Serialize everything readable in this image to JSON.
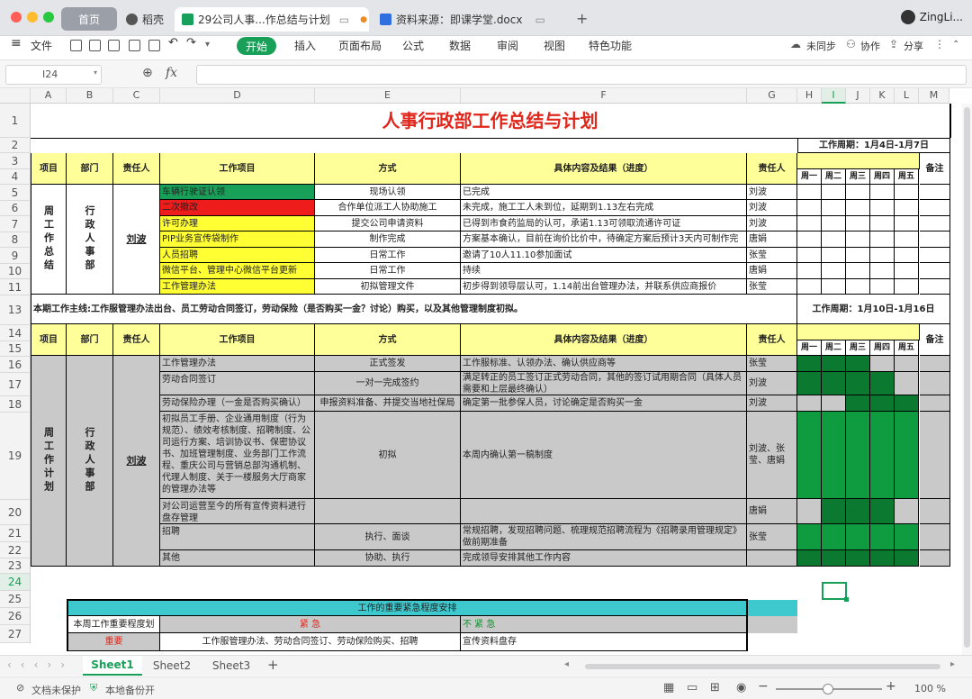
{
  "window": {
    "home_tab": "首页",
    "tab2": "稻壳",
    "tab3": "29公司人事...作总结与计划",
    "tab4": "资料来源：即课学堂.docx",
    "user": "ZingLi..."
  },
  "menu": {
    "file": "文件",
    "start": "开始",
    "insert": "插入",
    "layout": "页面布局",
    "formula": "公式",
    "data": "数据",
    "review": "审阅",
    "view": "视图",
    "special": "特色功能",
    "sync": "未同步",
    "collab": "协作",
    "share": "分享"
  },
  "formula_bar": {
    "cell_ref": "I24",
    "fx": "fx"
  },
  "columns": [
    "A",
    "B",
    "C",
    "D",
    "E",
    "F",
    "G",
    "H",
    "I",
    "J",
    "K",
    "L",
    "M"
  ],
  "rows": [
    "1",
    "2",
    "3",
    "4",
    "5",
    "6",
    "7",
    "8",
    "9",
    "10",
    "11",
    "13",
    "14",
    "15",
    "16",
    "17",
    "18",
    "19",
    "20",
    "21",
    "22",
    "23",
    "24",
    "25",
    "26",
    "27"
  ],
  "sheet": {
    "title": "人事行政部工作总结与计划",
    "period1": "工作周期：1月4日-1月7日",
    "period2": "工作周期：1月10日-1月16日",
    "headers": {
      "item": "项目",
      "dept": "部门",
      "owner": "责任人",
      "work": "工作项目",
      "method": "方式",
      "detail": "具体内容及结果（进度）",
      "resp": "责任人",
      "remark": "备注",
      "days": [
        "周一",
        "周二",
        "周三",
        "周四",
        "周五"
      ]
    },
    "s1": {
      "item": "周工作总结",
      "dept": "行政人事部",
      "owner": "刘波",
      "rows": [
        {
          "work": "车辆行驶证认领",
          "method": "现场认领",
          "detail": "已完成",
          "resp": "刘波"
        },
        {
          "work": "二次撤改",
          "method": "合作单位派工人协助施工",
          "detail": "未完成，施工工人未到位，延期到1.13左右完成",
          "resp": "刘波"
        },
        {
          "work": "许可办理",
          "method": "提交公司申请资料",
          "detail": "已得到市食药监局的认可，承诺1.13可领取流通许可证",
          "resp": "刘波"
        },
        {
          "work": "PIP业务宣传袋制作",
          "method": "制作完成",
          "detail": "方案基本确认，目前在询价比价中，待确定方案后预计3天内可制作完",
          "resp": "唐娟"
        },
        {
          "work": "人员招聘",
          "method": "日常工作",
          "detail": "邀请了10人11.10参加面试",
          "resp": "张莹"
        },
        {
          "work": "微信平台、管理中心微信平台更新",
          "method": "日常工作",
          "detail": "持续",
          "resp": "唐娟"
        },
        {
          "work": "工作管理办法",
          "method": "初拟管理文件",
          "detail": "初步得到领导层认可，1.14前出台管理办法，并联系供应商报价",
          "resp": "张莹"
        }
      ]
    },
    "mainline": "本期工作主线:工作服管理办法出台、员工劳动合同签订，劳动保险（是否购买一金？讨论）购买，以及其他管理制度初拟。",
    "s2": {
      "item": "周工作计划",
      "dept": "行政人事部",
      "owner": "刘波",
      "rows": [
        {
          "work": "工作管理办法",
          "method": "正式签发",
          "detail": "工作服标准、认领办法、确认供应商等",
          "resp": "张莹"
        },
        {
          "work": "劳动合同签订",
          "method": "一对一完成签约",
          "detail": "满足转正的员工签订正式劳动合同，其他的签订试用期合同（具体人员需要和上层最终确认）",
          "resp": "刘波"
        },
        {
          "work": "劳动保险办理（一金是否购买确认）",
          "method": "申报资料准备、并提交当地社保局",
          "detail": "确定第一批参保人员，讨论确定是否购买一金",
          "resp": "刘波"
        },
        {
          "work": "初拟员工手册、企业通用制度（行为规范）、绩效考核制度、招聘制度、公司运行方案、培训协议书、保密协议书、加班管理制度、业务部门工作流程、重庆公司与营销总部沟通机制、代理人制度、关于一楼服务大厅商家的管理办法等",
          "method": "初拟",
          "detail": "本周内确认第一稿制度",
          "resp": "刘波、张莹、唐娟"
        },
        {
          "work": "对公司运营至今的所有宣传资料进行盘存管理",
          "method": "",
          "detail": "",
          "resp": "唐娟"
        },
        {
          "work": "招聘",
          "method": "执行、面谈",
          "detail": "常规招聘，发现招聘问题、梳理规范招聘流程为《招聘录用管理规定》做前期准备",
          "resp": "张莹"
        },
        {
          "work": "其他",
          "method": "协助、执行",
          "detail": "完成领导安排其他工作内容",
          "resp": ""
        }
      ]
    },
    "urgency": {
      "title": "工作的重要紧急程度安排",
      "label": "本周工作重要程度划",
      "urgent": "紧 急",
      "not_urgent": "不 紧 急",
      "important": "重要",
      "urgent_items": "工作服管理办法、劳动合同签订、劳动保险购买、招聘",
      "not_urgent_items": "宣传资料盘存"
    }
  },
  "sheet_tabs": [
    "Sheet1",
    "Sheet2",
    "Sheet3"
  ],
  "status": {
    "protect": "文档未保护",
    "backup": "本地备份开",
    "zoom": "100 %"
  }
}
